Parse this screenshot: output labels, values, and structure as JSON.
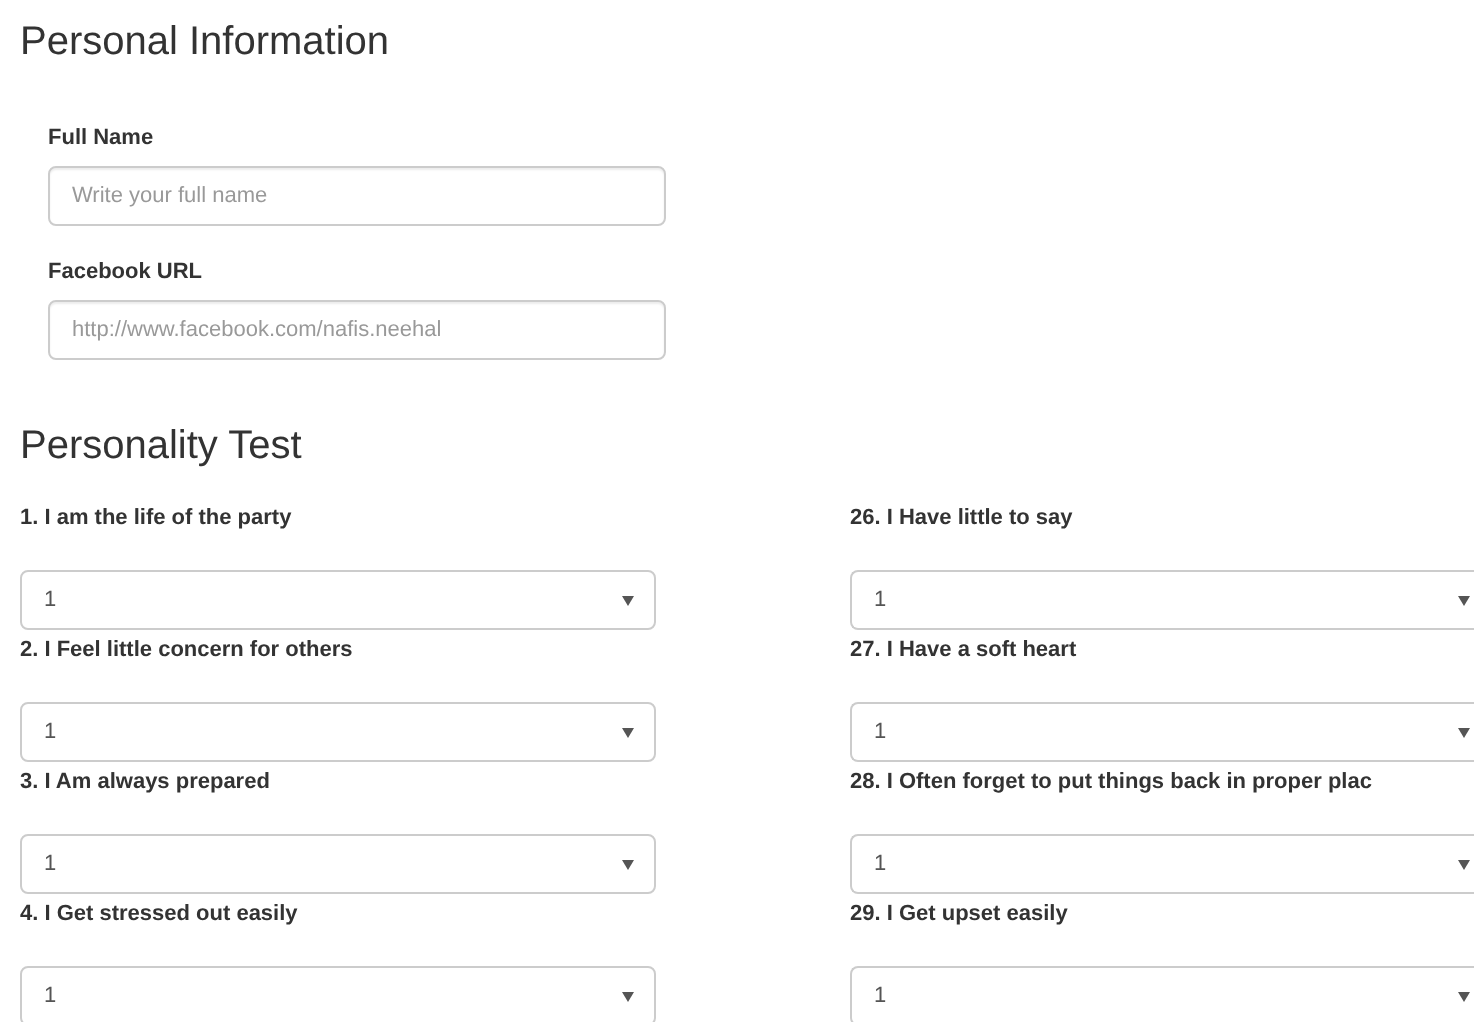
{
  "personal_information": {
    "title": "Personal Information",
    "fields": [
      {
        "label": "Full Name",
        "placeholder": "Write your full name"
      },
      {
        "label": "Facebook URL",
        "placeholder": "http://www.facebook.com/nafis.neehal"
      }
    ]
  },
  "personality_test": {
    "title": "Personality Test",
    "columns": [
      [
        {
          "question": "1. I am the life of the party",
          "value": "1"
        },
        {
          "question": "2. I Feel little concern for others",
          "value": "1"
        },
        {
          "question": "3. I Am always prepared",
          "value": "1"
        },
        {
          "question": "4. I Get stressed out easily",
          "value": "1"
        }
      ],
      [
        {
          "question": "26. I Have little to say",
          "value": "1"
        },
        {
          "question": "27. I Have a soft heart",
          "value": "1"
        },
        {
          "question": "28. I Often forget to put things back in proper plac",
          "value": "1"
        },
        {
          "question": "29. I Get upset easily",
          "value": "1"
        }
      ]
    ]
  }
}
